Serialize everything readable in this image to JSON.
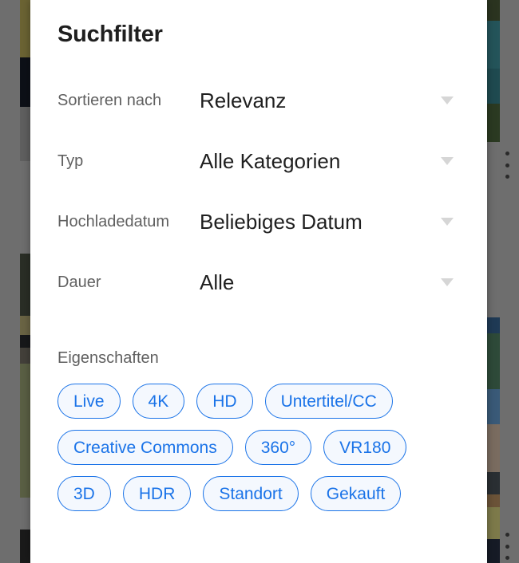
{
  "dialog": {
    "title": "Suchfilter",
    "filters": [
      {
        "label": "Sortieren nach",
        "value": "Relevanz",
        "caret": "chevron-down-icon"
      },
      {
        "label": "Typ",
        "value": "Alle Kategorien",
        "caret": "chevron-down-icon"
      },
      {
        "label": "Hochladedatum",
        "value": "Beliebiges Datum",
        "caret": "chevron-down-icon"
      },
      {
        "label": "Dauer",
        "value": "Alle",
        "caret": "chevron-down-icon"
      }
    ],
    "properties": {
      "heading": "Eigenschaften",
      "chips": [
        "Live",
        "4K",
        "HD",
        "Untertitel/CC",
        "Creative Commons",
        "360°",
        "VR180",
        "3D",
        "HDR",
        "Standort",
        "Gekauft"
      ]
    }
  },
  "background": {
    "overflow_icons": [
      {
        "name": "more-options-icon",
        "glyph": "⋮"
      },
      {
        "name": "more-options-icon",
        "glyph": "⋮"
      }
    ]
  },
  "colors": {
    "accent": "#1a73e8",
    "chip_fill": "#f4f8fe",
    "sheet_bg": "#ffffff",
    "scrim": "#6e6e6e",
    "label_text": "#606060",
    "value_text": "#1f1f1f",
    "caret": "#d6d6d6"
  }
}
